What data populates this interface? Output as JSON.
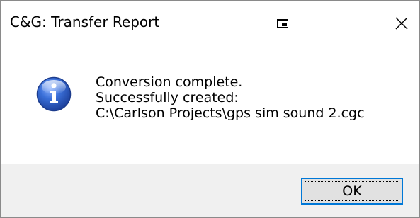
{
  "window": {
    "title": "C&G: Transfer Report",
    "title_icon": "window-restore-icon",
    "close_icon": "close-icon"
  },
  "message": {
    "icon": "info-icon",
    "lines": [
      "Conversion complete.",
      "Successfully created:",
      "C:\\Carlson Projects\\gps sim sound 2.cgc"
    ]
  },
  "buttons": {
    "ok_label": "OK"
  },
  "colors": {
    "footer_bg": "#f0f0f0",
    "button_bg": "#e1e1e1",
    "button_focus_border": "#0078d7",
    "info_icon_blue": "#2a62c9"
  }
}
